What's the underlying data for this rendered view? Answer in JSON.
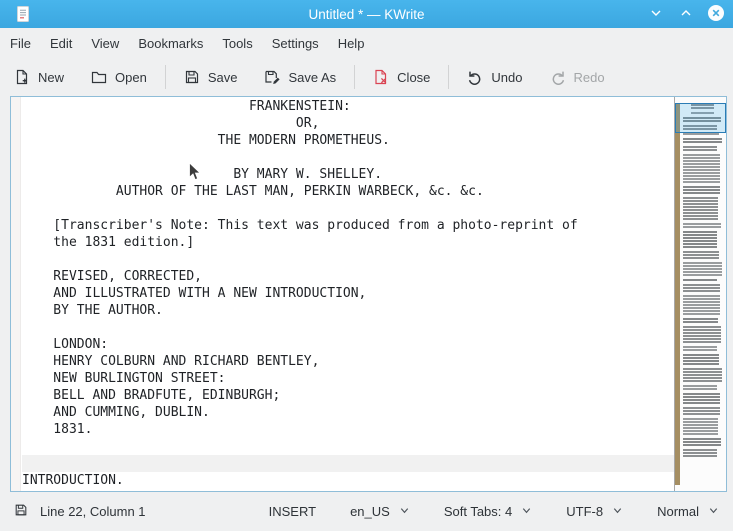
{
  "window": {
    "title": "Untitled * — KWrite"
  },
  "menubar": {
    "items": [
      "File",
      "Edit",
      "View",
      "Bookmarks",
      "Tools",
      "Settings",
      "Help"
    ]
  },
  "toolbar": {
    "buttons": [
      {
        "label": "New",
        "icon": "new-document-icon",
        "enabled": true,
        "sep_after": false
      },
      {
        "label": "Open",
        "icon": "open-folder-icon",
        "enabled": true,
        "sep_after": true
      },
      {
        "label": "Save",
        "icon": "save-icon",
        "enabled": true,
        "sep_after": false
      },
      {
        "label": "Save As",
        "icon": "save-as-icon",
        "enabled": true,
        "sep_after": true
      },
      {
        "label": "Close",
        "icon": "close-document-icon",
        "enabled": true,
        "sep_after": true
      },
      {
        "label": "Undo",
        "icon": "undo-icon",
        "enabled": true,
        "sep_after": false
      },
      {
        "label": "Redo",
        "icon": "redo-icon",
        "enabled": false,
        "sep_after": false
      }
    ]
  },
  "editor": {
    "current_line_number": 22,
    "lines": [
      "                             FRANKENSTEIN:",
      "                                   OR,",
      "                         THE MODERN PROMETHEUS.",
      "",
      "                           BY MARY W. SHELLEY.",
      "            AUTHOR OF THE LAST MAN, PERKIN WARBECK, &c. &c.",
      "",
      "    [Transcriber's Note: This text was produced from a photo-reprint of",
      "    the 1831 edition.]",
      "",
      "    REVISED, CORRECTED,",
      "    AND ILLUSTRATED WITH A NEW INTRODUCTION,",
      "    BY THE AUTHOR.",
      "",
      "    LONDON:",
      "    HENRY COLBURN AND RICHARD BENTLEY,",
      "    NEW BURLINGTON STREET:",
      "    BELL AND BRADFUTE, EDINBURGH;",
      "    AND CUMMING, DUBLIN.",
      "    1831.",
      "",
      "",
      "INTRODUCTION."
    ]
  },
  "statusbar": {
    "cursor_position": "Line 22, Column 1",
    "input_mode": "INSERT",
    "dictionary": "en_US",
    "tab_mode": "Soft Tabs: 4",
    "encoding": "UTF-8",
    "highlight_mode": "Normal"
  },
  "colors": {
    "titlebar_blue": "#3daee9",
    "window_bg": "#eff0f1",
    "danger_red": "#da4453",
    "modified_marker_tan": "#a58e62",
    "current_line_bg": "#f1f1f1",
    "viewport_border_blue": "#2a7cb5"
  }
}
